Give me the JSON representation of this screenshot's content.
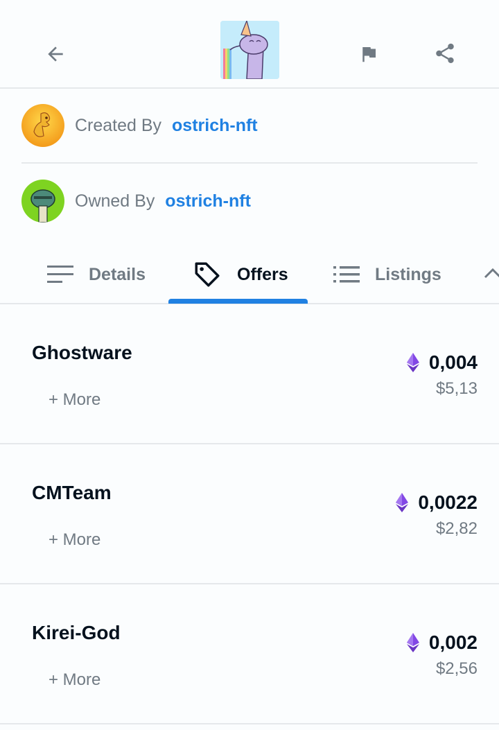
{
  "header": {
    "back_icon": "arrow-left-icon",
    "flag_icon": "flag-icon",
    "share_icon": "share-icon",
    "thumbnail": "nft-thumbnail"
  },
  "creator": {
    "label": "Created By",
    "name": "ostrich-nft"
  },
  "owner": {
    "label": "Owned By",
    "name": "ostrich-nft"
  },
  "tabs": [
    {
      "label": "Details",
      "icon": "lines-icon"
    },
    {
      "label": "Offers",
      "icon": "tag-icon"
    },
    {
      "label": "Listings",
      "icon": "list-icon"
    }
  ],
  "active_tab": "Offers",
  "offers": [
    {
      "name": "Ghostware",
      "more": "+ More",
      "price": "0,004",
      "usd": "$5,13"
    },
    {
      "name": "CMTeam",
      "more": "+ More",
      "price": "0,0022",
      "usd": "$2,82"
    },
    {
      "name": "Kirei-God",
      "more": "+ More",
      "price": "0,002",
      "usd": "$2,56"
    }
  ],
  "colors": {
    "link": "#2081e2",
    "muted": "#707a83",
    "text": "#04111d",
    "eth": "#8247e5"
  }
}
